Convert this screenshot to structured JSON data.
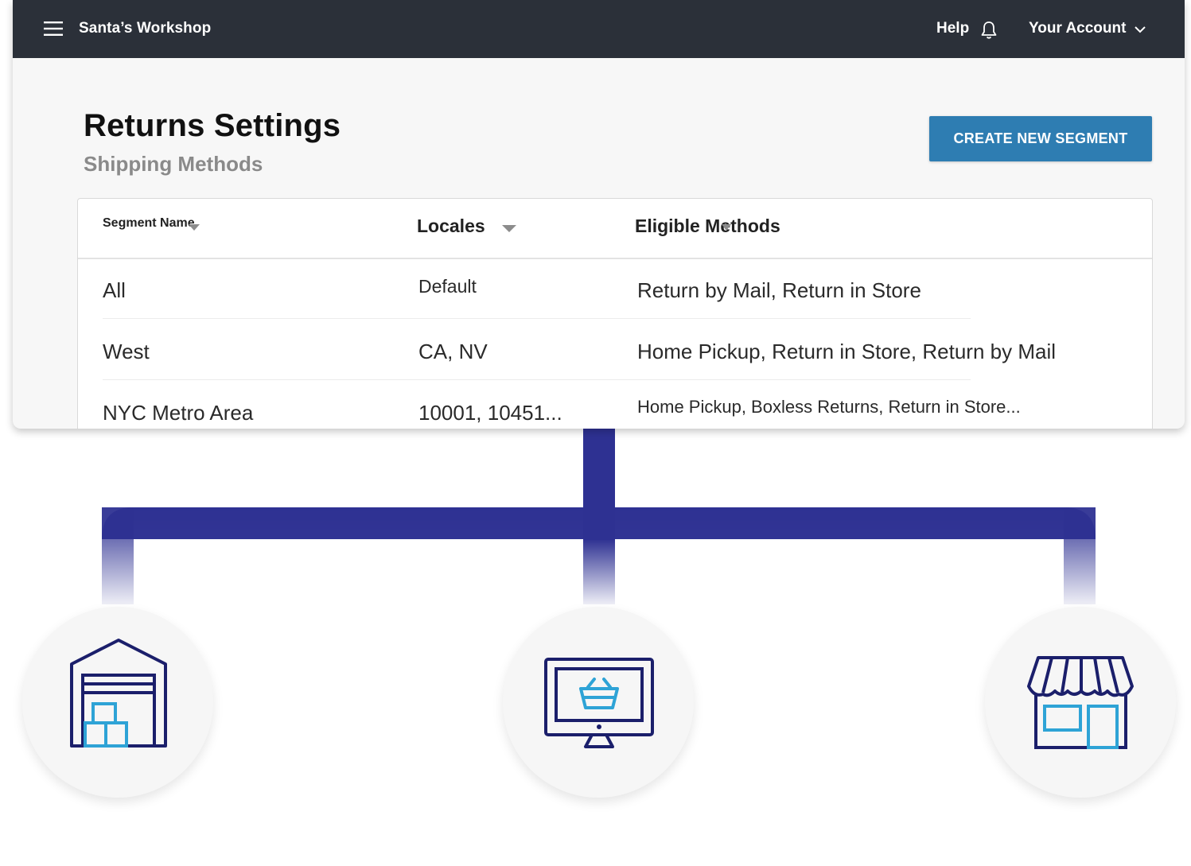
{
  "topbar": {
    "brand": "Santa’s Workshop",
    "help_label": "Help",
    "account_label": "Your Account",
    "icons": [
      "hamburger-menu-icon",
      "bell-icon",
      "chevron-down-icon"
    ]
  },
  "page": {
    "title": "Returns Settings",
    "subtitle": "Shipping Methods",
    "create_button_label": "CREATE NEW SEGMENT"
  },
  "table": {
    "columns": [
      "Segment Name",
      "Locales",
      "Eligible Methods"
    ],
    "rows": [
      {
        "name": "All",
        "locales": "Default",
        "methods": "Return by Mail, Return in Store"
      },
      {
        "name": "West",
        "locales": "CA, NV",
        "methods": "Home Pickup, Return in Store, Return by Mail"
      },
      {
        "name": "NYC Metro Area",
        "locales": "10001, 10451...",
        "methods": "Home Pickup, Boxless Returns, Return in Store..."
      }
    ]
  },
  "diagram": {
    "nodes": [
      "warehouse-icon",
      "online-shop-computer-icon",
      "storefront-icon"
    ]
  },
  "colors": {
    "topbar": "#2b3039",
    "button": "#2e7db2",
    "connector": "#2e3192",
    "icon_dark": "#1b1f6b",
    "icon_accent": "#2ea3d6"
  }
}
